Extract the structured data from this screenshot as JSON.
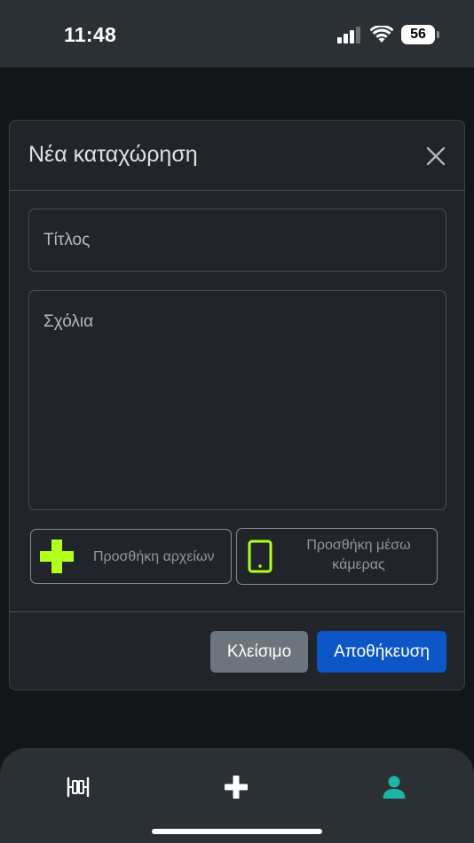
{
  "status_bar": {
    "time": "11:48",
    "battery": "56",
    "icons": [
      "signal-icon",
      "wifi-icon",
      "battery-icon"
    ]
  },
  "modal": {
    "title": "Νέα καταχώρηση",
    "close_icon": "close-icon",
    "title_field": {
      "placeholder": "Τίτλος",
      "value": ""
    },
    "comments_field": {
      "placeholder": "Σχόλια",
      "value": ""
    },
    "attach_files": {
      "label": "Προσθήκη αρχείων",
      "icon": "plus-icon"
    },
    "attach_camera": {
      "label_line1": "Προσθήκη μέσω",
      "label_line2": "κάμερας",
      "icon": "phone-icon"
    },
    "close_button": "Κλείσιμο",
    "save_button": "Αποθήκευση"
  },
  "tab_bar": {
    "items": [
      {
        "name": "home",
        "icon": "vertical-split-icon"
      },
      {
        "name": "add",
        "icon": "plus-icon"
      },
      {
        "name": "profile",
        "icon": "person-icon",
        "active": true
      }
    ]
  },
  "colors": {
    "accent_green": "#b2ff1a",
    "primary_blue": "#0d56c7",
    "secondary_gray": "#6c757d",
    "profile_teal": "#1fb5a5"
  }
}
